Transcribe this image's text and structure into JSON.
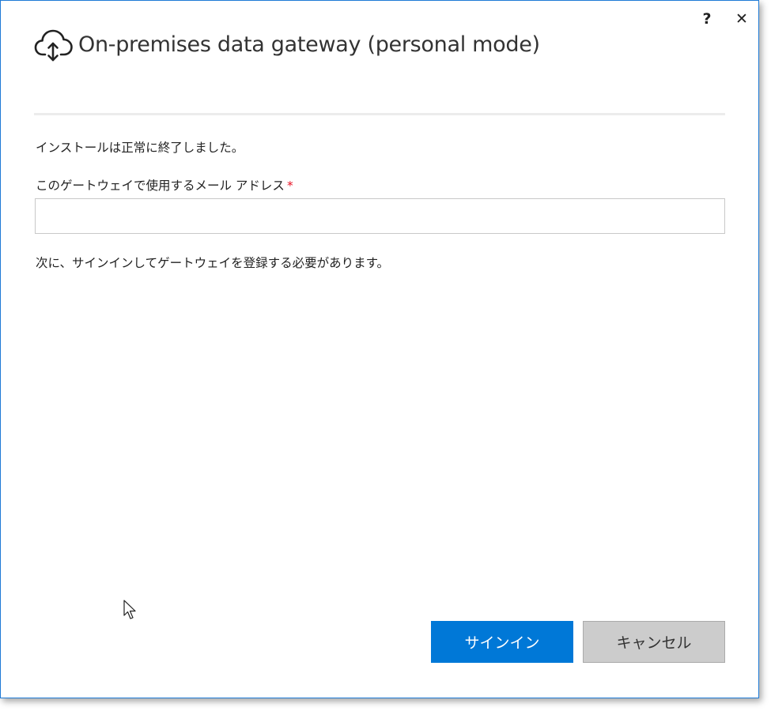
{
  "window": {
    "title": "On-premises data gateway (personal mode)",
    "help_label": "?",
    "close_label": "✕"
  },
  "content": {
    "status_message": "インストールは正常に終了しました。",
    "email_label": "このゲートウェイで使用するメール アドレス",
    "required_marker": "*",
    "email_value": "",
    "email_placeholder": "",
    "next_message": "次に、サインインしてゲートウェイを登録する必要があります。"
  },
  "buttons": {
    "sign_in_label": "サインイン",
    "cancel_label": "キャンセル"
  },
  "icons": {
    "header": "cloud-upload-download-icon",
    "help": "question-mark-icon",
    "close": "close-icon",
    "cursor": "mouse-pointer-icon"
  },
  "colors": {
    "accent": "#0078d7",
    "window_border": "#1e7ad6",
    "required": "#e81123",
    "secondary_button": "#cccccc"
  }
}
